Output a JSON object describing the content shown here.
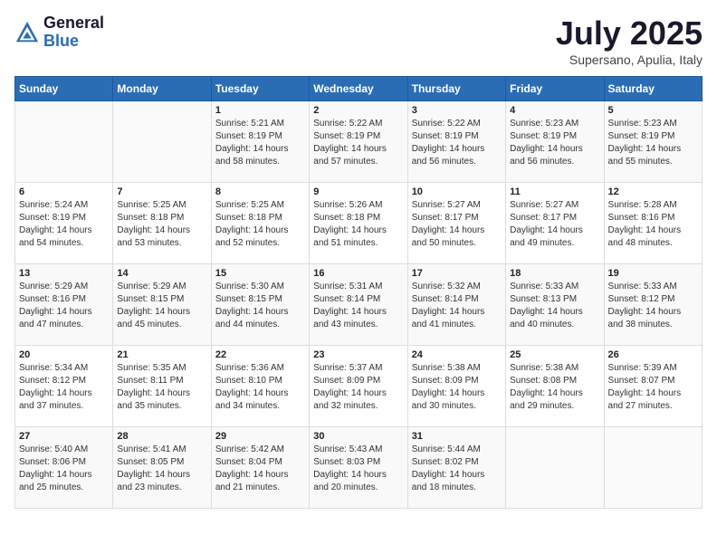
{
  "header": {
    "logo_general": "General",
    "logo_blue": "Blue",
    "month_title": "July 2025",
    "subtitle": "Supersano, Apulia, Italy"
  },
  "days_of_week": [
    "Sunday",
    "Monday",
    "Tuesday",
    "Wednesday",
    "Thursday",
    "Friday",
    "Saturday"
  ],
  "weeks": [
    [
      {
        "day": "",
        "sunrise": "",
        "sunset": "",
        "daylight": ""
      },
      {
        "day": "",
        "sunrise": "",
        "sunset": "",
        "daylight": ""
      },
      {
        "day": "1",
        "sunrise": "Sunrise: 5:21 AM",
        "sunset": "Sunset: 8:19 PM",
        "daylight": "Daylight: 14 hours and 58 minutes."
      },
      {
        "day": "2",
        "sunrise": "Sunrise: 5:22 AM",
        "sunset": "Sunset: 8:19 PM",
        "daylight": "Daylight: 14 hours and 57 minutes."
      },
      {
        "day": "3",
        "sunrise": "Sunrise: 5:22 AM",
        "sunset": "Sunset: 8:19 PM",
        "daylight": "Daylight: 14 hours and 56 minutes."
      },
      {
        "day": "4",
        "sunrise": "Sunrise: 5:23 AM",
        "sunset": "Sunset: 8:19 PM",
        "daylight": "Daylight: 14 hours and 56 minutes."
      },
      {
        "day": "5",
        "sunrise": "Sunrise: 5:23 AM",
        "sunset": "Sunset: 8:19 PM",
        "daylight": "Daylight: 14 hours and 55 minutes."
      }
    ],
    [
      {
        "day": "6",
        "sunrise": "Sunrise: 5:24 AM",
        "sunset": "Sunset: 8:19 PM",
        "daylight": "Daylight: 14 hours and 54 minutes."
      },
      {
        "day": "7",
        "sunrise": "Sunrise: 5:25 AM",
        "sunset": "Sunset: 8:18 PM",
        "daylight": "Daylight: 14 hours and 53 minutes."
      },
      {
        "day": "8",
        "sunrise": "Sunrise: 5:25 AM",
        "sunset": "Sunset: 8:18 PM",
        "daylight": "Daylight: 14 hours and 52 minutes."
      },
      {
        "day": "9",
        "sunrise": "Sunrise: 5:26 AM",
        "sunset": "Sunset: 8:18 PM",
        "daylight": "Daylight: 14 hours and 51 minutes."
      },
      {
        "day": "10",
        "sunrise": "Sunrise: 5:27 AM",
        "sunset": "Sunset: 8:17 PM",
        "daylight": "Daylight: 14 hours and 50 minutes."
      },
      {
        "day": "11",
        "sunrise": "Sunrise: 5:27 AM",
        "sunset": "Sunset: 8:17 PM",
        "daylight": "Daylight: 14 hours and 49 minutes."
      },
      {
        "day": "12",
        "sunrise": "Sunrise: 5:28 AM",
        "sunset": "Sunset: 8:16 PM",
        "daylight": "Daylight: 14 hours and 48 minutes."
      }
    ],
    [
      {
        "day": "13",
        "sunrise": "Sunrise: 5:29 AM",
        "sunset": "Sunset: 8:16 PM",
        "daylight": "Daylight: 14 hours and 47 minutes."
      },
      {
        "day": "14",
        "sunrise": "Sunrise: 5:29 AM",
        "sunset": "Sunset: 8:15 PM",
        "daylight": "Daylight: 14 hours and 45 minutes."
      },
      {
        "day": "15",
        "sunrise": "Sunrise: 5:30 AM",
        "sunset": "Sunset: 8:15 PM",
        "daylight": "Daylight: 14 hours and 44 minutes."
      },
      {
        "day": "16",
        "sunrise": "Sunrise: 5:31 AM",
        "sunset": "Sunset: 8:14 PM",
        "daylight": "Daylight: 14 hours and 43 minutes."
      },
      {
        "day": "17",
        "sunrise": "Sunrise: 5:32 AM",
        "sunset": "Sunset: 8:14 PM",
        "daylight": "Daylight: 14 hours and 41 minutes."
      },
      {
        "day": "18",
        "sunrise": "Sunrise: 5:33 AM",
        "sunset": "Sunset: 8:13 PM",
        "daylight": "Daylight: 14 hours and 40 minutes."
      },
      {
        "day": "19",
        "sunrise": "Sunrise: 5:33 AM",
        "sunset": "Sunset: 8:12 PM",
        "daylight": "Daylight: 14 hours and 38 minutes."
      }
    ],
    [
      {
        "day": "20",
        "sunrise": "Sunrise: 5:34 AM",
        "sunset": "Sunset: 8:12 PM",
        "daylight": "Daylight: 14 hours and 37 minutes."
      },
      {
        "day": "21",
        "sunrise": "Sunrise: 5:35 AM",
        "sunset": "Sunset: 8:11 PM",
        "daylight": "Daylight: 14 hours and 35 minutes."
      },
      {
        "day": "22",
        "sunrise": "Sunrise: 5:36 AM",
        "sunset": "Sunset: 8:10 PM",
        "daylight": "Daylight: 14 hours and 34 minutes."
      },
      {
        "day": "23",
        "sunrise": "Sunrise: 5:37 AM",
        "sunset": "Sunset: 8:09 PM",
        "daylight": "Daylight: 14 hours and 32 minutes."
      },
      {
        "day": "24",
        "sunrise": "Sunrise: 5:38 AM",
        "sunset": "Sunset: 8:09 PM",
        "daylight": "Daylight: 14 hours and 30 minutes."
      },
      {
        "day": "25",
        "sunrise": "Sunrise: 5:38 AM",
        "sunset": "Sunset: 8:08 PM",
        "daylight": "Daylight: 14 hours and 29 minutes."
      },
      {
        "day": "26",
        "sunrise": "Sunrise: 5:39 AM",
        "sunset": "Sunset: 8:07 PM",
        "daylight": "Daylight: 14 hours and 27 minutes."
      }
    ],
    [
      {
        "day": "27",
        "sunrise": "Sunrise: 5:40 AM",
        "sunset": "Sunset: 8:06 PM",
        "daylight": "Daylight: 14 hours and 25 minutes."
      },
      {
        "day": "28",
        "sunrise": "Sunrise: 5:41 AM",
        "sunset": "Sunset: 8:05 PM",
        "daylight": "Daylight: 14 hours and 23 minutes."
      },
      {
        "day": "29",
        "sunrise": "Sunrise: 5:42 AM",
        "sunset": "Sunset: 8:04 PM",
        "daylight": "Daylight: 14 hours and 21 minutes."
      },
      {
        "day": "30",
        "sunrise": "Sunrise: 5:43 AM",
        "sunset": "Sunset: 8:03 PM",
        "daylight": "Daylight: 14 hours and 20 minutes."
      },
      {
        "day": "31",
        "sunrise": "Sunrise: 5:44 AM",
        "sunset": "Sunset: 8:02 PM",
        "daylight": "Daylight: 14 hours and 18 minutes."
      },
      {
        "day": "",
        "sunrise": "",
        "sunset": "",
        "daylight": ""
      },
      {
        "day": "",
        "sunrise": "",
        "sunset": "",
        "daylight": ""
      }
    ]
  ]
}
